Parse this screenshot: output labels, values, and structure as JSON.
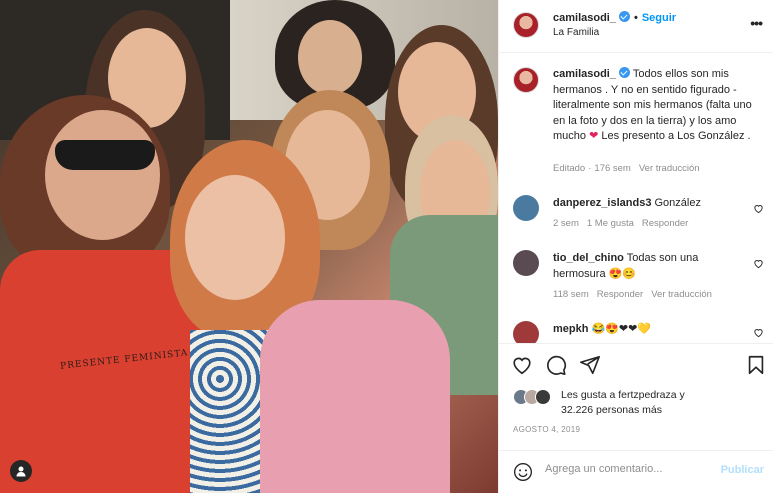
{
  "photo": {
    "shirt_text": "PRESENTE FEMINISTA",
    "user_tag_icon": "person-icon"
  },
  "header": {
    "username": "camilasodi_",
    "verified": true,
    "separator": "•",
    "follow_label": "Seguir",
    "location": "La Familia",
    "more_icon": "more-horizontal-icon"
  },
  "caption": {
    "username": "camilasodi_",
    "text_part1": " Todos ellos son mis hermanos . Y no en sentido figurado - literalmente son mis hermanos (falta uno en la foto y dos en la tierra) y los amo mucho ",
    "emoji": "❤",
    "text_part2": " Les presento a Los González .",
    "edited": "Editado",
    "separator": "·",
    "age": "176 sem",
    "translate": "Ver traducción"
  },
  "comments": [
    {
      "username": "danperez_islands3",
      "text": " González",
      "age": "2 sem",
      "likes": "1 Me gusta",
      "reply": "Responder",
      "avatar_color": "#4a7aa0"
    },
    {
      "username": "tio_del_chino",
      "text": " Todas son una hermosura 😍😊",
      "age": "118 sem",
      "reply": "Responder",
      "translate": "Ver traducción",
      "avatar_color": "#5a4a52"
    },
    {
      "username": "mepkh",
      "text": " 😂😍❤❤💛",
      "avatar_color": "#a03a3a"
    }
  ],
  "actions": {
    "like_icon": "heart-icon",
    "comment_icon": "comment-icon",
    "share_icon": "share-icon",
    "save_icon": "bookmark-icon"
  },
  "likes": {
    "line1_prefix": "Les gusta a ",
    "line1_user": "fertzpedraza",
    "line1_suffix": " y",
    "line2": "32.226 personas más"
  },
  "date": "AGOSTO 4, 2019",
  "add_comment": {
    "placeholder": "Agrega un comentario...",
    "publish_label": "Publicar",
    "emoji_icon": "smiley-icon"
  },
  "colors": {
    "accent": "#0095f6",
    "verified": "#3897f0",
    "muted": "#8e8e8e",
    "publish_disabled": "#b2dffc"
  }
}
